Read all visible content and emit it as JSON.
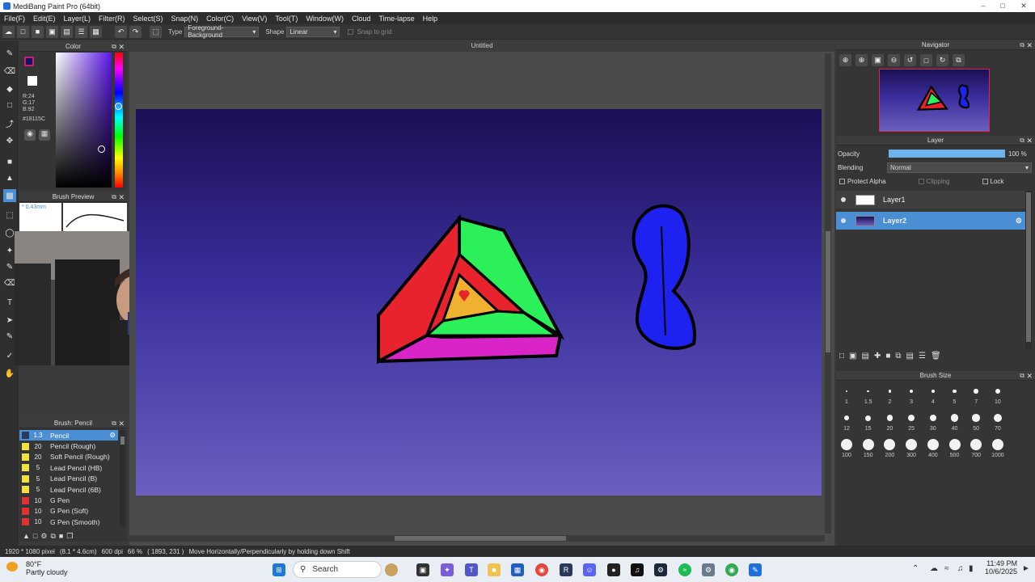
{
  "window": {
    "title": "MediBang Paint Pro (64bit)"
  },
  "menu": [
    "File(F)",
    "Edit(E)",
    "Layer(L)",
    "Filter(R)",
    "Select(S)",
    "Snap(N)",
    "Color(C)",
    "View(V)",
    "Tool(T)",
    "Window(W)",
    "Cloud",
    "Time-lapse",
    "Help"
  ],
  "toolbar": {
    "type_label": "Type",
    "type_value": "Foreground-Background",
    "shape_label": "Shape",
    "shape_value": "Linear",
    "snap_label": "Snap to grid"
  },
  "color_panel": {
    "title": "Color",
    "r": "R:24",
    "g": "G:17",
    "b": "B:92",
    "hex": "#18115C",
    "fg_color": "#18115C",
    "bg_color": "#ffffff"
  },
  "brush_preview": {
    "title": "Brush Preview",
    "size": "* 0.43mm"
  },
  "document": {
    "tab": "Untitled"
  },
  "brush_list": {
    "title": "Brush: Pencil",
    "items": [
      {
        "size": "1.3",
        "name": "Pencil",
        "color": "#2a3a5a"
      },
      {
        "size": "20",
        "name": "Pencil (Rough)",
        "color": "#f0e040"
      },
      {
        "size": "20",
        "name": "Soft Pencil (Rough)",
        "color": "#f0e040"
      },
      {
        "size": "5",
        "name": "Lead Pencil (HB)",
        "color": "#f0e040"
      },
      {
        "size": "5",
        "name": "Lead Pencil (B)",
        "color": "#f0e040"
      },
      {
        "size": "5",
        "name": "Lead Pencil (6B)",
        "color": "#f0e040"
      },
      {
        "size": "10",
        "name": "G Pen",
        "color": "#e03030"
      },
      {
        "size": "10",
        "name": "G Pen (Soft)",
        "color": "#e03030"
      },
      {
        "size": "10",
        "name": "G Pen (Smooth)",
        "color": "#e03030"
      }
    ]
  },
  "navigator": {
    "title": "Navigator"
  },
  "layer_panel": {
    "title": "Layer",
    "opacity_label": "Opacity",
    "opacity_value": "100 %",
    "opacity": 1.0,
    "blending_label": "Blending",
    "blending_value": "Normal",
    "protect_alpha": "Protect Alpha",
    "clipping": "Clipping",
    "lock": "Lock",
    "layers": [
      {
        "name": "Layer1",
        "selected": false
      },
      {
        "name": "Layer2",
        "selected": true
      }
    ]
  },
  "brush_size": {
    "title": "Brush Size",
    "sizes": [
      "1",
      "1.5",
      "2",
      "3",
      "4",
      "5",
      "7",
      "10",
      "12",
      "15",
      "20",
      "25",
      "30",
      "40",
      "50",
      "70",
      "100",
      "150",
      "200",
      "300",
      "400",
      "500",
      "700",
      "1000"
    ]
  },
  "status": {
    "dimensions": "1920 * 1080 pixel",
    "physical": "(8.1 * 4.6cm)",
    "dpi": "600 dpi",
    "zoom": "66 %",
    "cursor": "( 1893, 231 )",
    "hint": "Move Horizontally/Perpendicularly by holding down Shift"
  },
  "taskbar": {
    "temp": "80°F",
    "weather": "Partly cloudy",
    "search": "Search",
    "time": "11:49 PM",
    "date": "10/6/2025"
  }
}
